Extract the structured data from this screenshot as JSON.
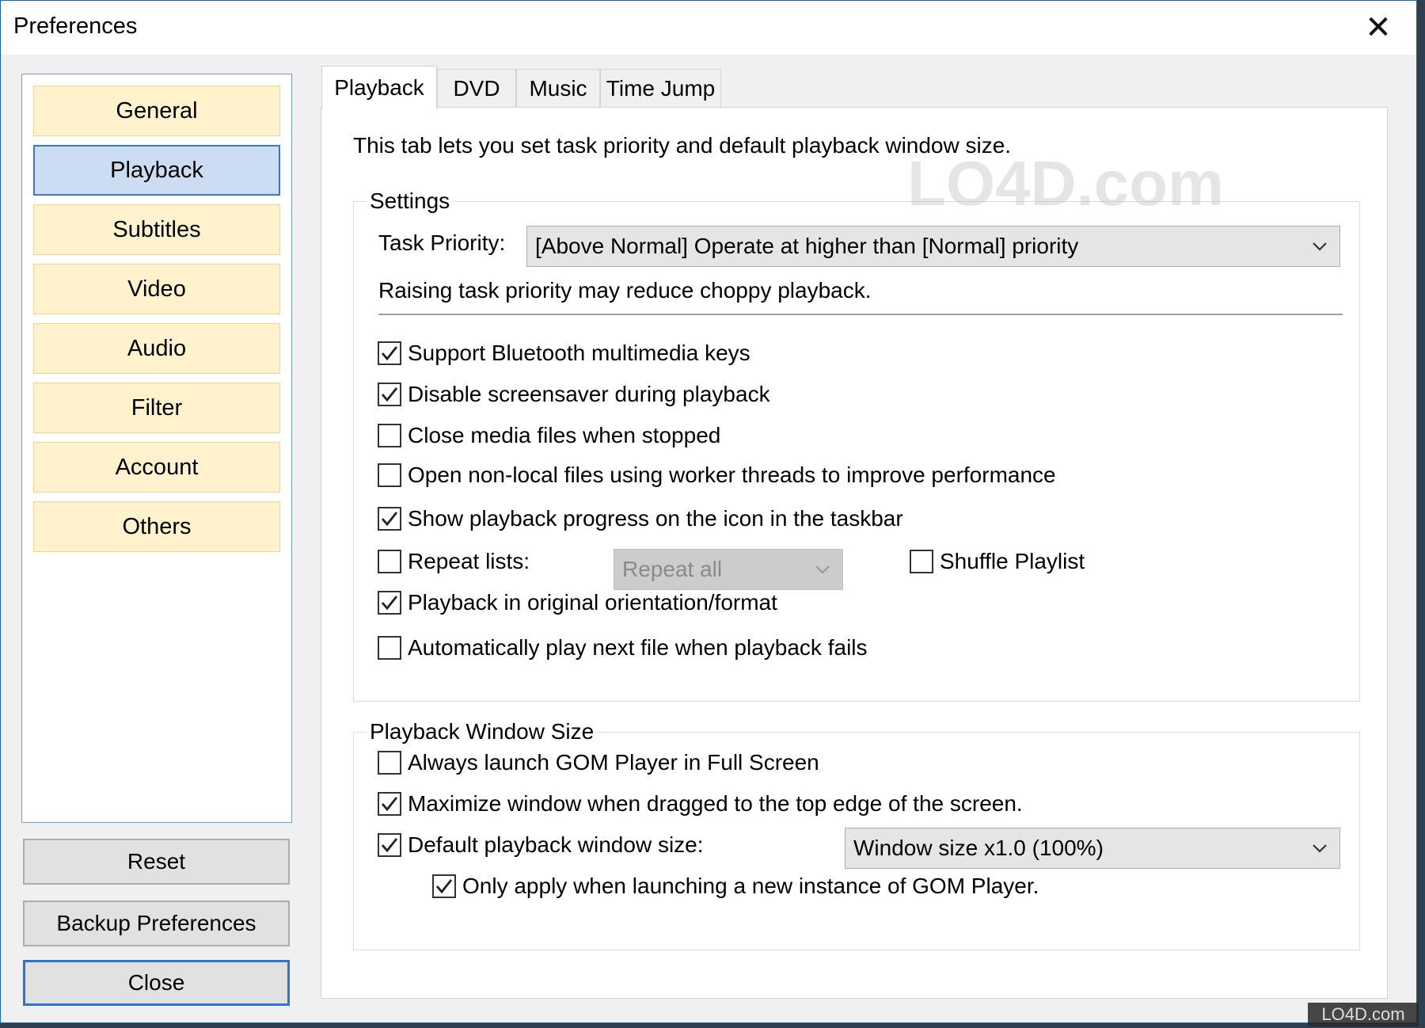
{
  "window": {
    "title": "Preferences"
  },
  "nav": {
    "items": [
      {
        "label": "General",
        "active": false
      },
      {
        "label": "Playback",
        "active": true
      },
      {
        "label": "Subtitles",
        "active": false
      },
      {
        "label": "Video",
        "active": false
      },
      {
        "label": "Audio",
        "active": false
      },
      {
        "label": "Filter",
        "active": false
      },
      {
        "label": "Account",
        "active": false
      },
      {
        "label": "Others",
        "active": false
      }
    ],
    "reset": "Reset",
    "backup": "Backup Preferences",
    "close": "Close"
  },
  "tabs": [
    {
      "label": "Playback",
      "active": true
    },
    {
      "label": "DVD",
      "active": false
    },
    {
      "label": "Music",
      "active": false
    },
    {
      "label": "Time Jump",
      "active": false
    }
  ],
  "page": {
    "description": "This tab lets you set task priority and default playback window size.",
    "settings": {
      "legend": "Settings",
      "task_priority_label": "Task Priority:",
      "task_priority_value": "[Above Normal] Operate at higher than [Normal] priority",
      "priority_note": "Raising task priority may reduce choppy playback.",
      "options": [
        {
          "label": "Support Bluetooth multimedia keys",
          "checked": true
        },
        {
          "label": "Disable screensaver during playback",
          "checked": true
        },
        {
          "label": "Close media files when stopped",
          "checked": false
        },
        {
          "label": "Open non-local files using worker threads to improve performance",
          "checked": false
        },
        {
          "label": "Show playback progress on the icon in the taskbar",
          "checked": true
        },
        {
          "label": "Repeat lists:",
          "checked": false
        },
        {
          "label": "Playback in original orientation/format",
          "checked": true
        },
        {
          "label": "Automatically play next file when playback fails",
          "checked": false
        }
      ],
      "repeat_mode_value": "Repeat all",
      "shuffle": {
        "label": "Shuffle Playlist",
        "checked": false
      }
    },
    "window_size": {
      "legend": "Playback Window Size",
      "options": [
        {
          "label": "Always launch GOM Player in Full Screen",
          "checked": false
        },
        {
          "label": "Maximize window when dragged to the top edge of the screen.",
          "checked": true
        },
        {
          "label": "Default playback window size:",
          "checked": true
        },
        {
          "label": "Only apply when launching a new instance of GOM Player.",
          "checked": true
        }
      ],
      "size_value": "Window size x1.0 (100%)"
    }
  },
  "watermark": {
    "main": "LO4D.com",
    "corner": "LO4D.com"
  }
}
